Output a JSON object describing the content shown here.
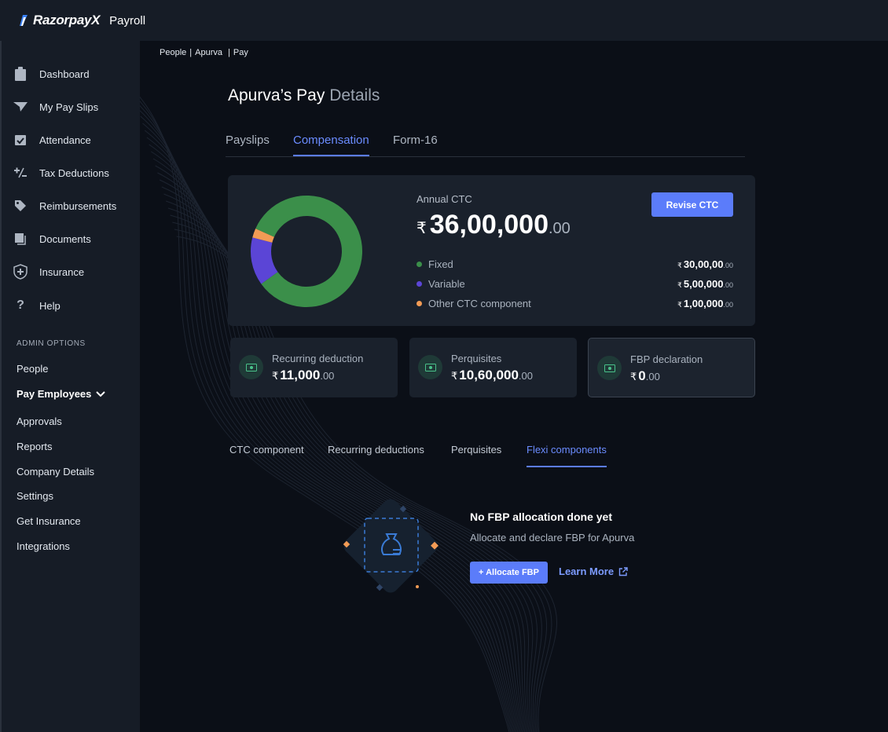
{
  "header": {
    "brand": "RazorpayX",
    "product": "Payroll"
  },
  "sidebar": {
    "items": [
      {
        "label": "Dashboard",
        "icon": "clipboard-icon"
      },
      {
        "label": "My Pay Slips",
        "icon": "paper-plane-icon"
      },
      {
        "label": "Attendance",
        "icon": "calendar-check-icon"
      },
      {
        "label": "Tax Deductions",
        "icon": "plus-minus-icon"
      },
      {
        "label": "Reimbursements",
        "icon": "tag-icon"
      },
      {
        "label": "Documents",
        "icon": "documents-icon"
      },
      {
        "label": "Insurance",
        "icon": "shield-plus-icon"
      },
      {
        "label": "Help",
        "icon": "question-icon"
      }
    ],
    "admin_title": "ADMIN OPTIONS",
    "admin_items": [
      "People",
      "Pay Employees",
      "Approvals",
      "Reports",
      "Company Details",
      "Settings",
      "Get Insurance",
      "Integrations"
    ]
  },
  "breadcrumb": [
    "People",
    "Apurva",
    "Pay"
  ],
  "page": {
    "title_strong": "Apurva’s Pay",
    "title_light": "Details"
  },
  "tabs": [
    "Payslips",
    "Compensation",
    "Form-16"
  ],
  "ctc": {
    "label": "Annual CTC",
    "currency": "₹",
    "amount": "36,00,000",
    "decimal": ".00",
    "revise_label": "Revise CTC",
    "breakdown": [
      {
        "label": "Fixed",
        "amount": "30,00,00",
        "decimal": ".00",
        "color": "#3b8f4a"
      },
      {
        "label": "Variable",
        "amount": "5,00,000",
        "decimal": ".00",
        "color": "#5b45d6"
      },
      {
        "label": "Other CTC component",
        "amount": "1,00,000",
        "decimal": ".00",
        "color": "#f29b55"
      }
    ]
  },
  "chart_data": {
    "type": "pie",
    "categories": [
      "Fixed",
      "Variable",
      "Other CTC component"
    ],
    "values": [
      3000000,
      500000,
      100000
    ]
  },
  "stats": [
    {
      "label": "Recurring deduction",
      "currency": "₹",
      "amount": "11,000",
      "decimal": ".00",
      "icon": "money-icon"
    },
    {
      "label": "Perquisites",
      "currency": "₹",
      "amount": "10,60,000",
      "decimal": ".00",
      "icon": "money-icon"
    },
    {
      "label": "FBP declaration",
      "currency": "₹",
      "amount": "0",
      "decimal": ".00",
      "icon": "money-icon"
    }
  ],
  "subtabs": [
    "CTC component",
    "Recurring deductions",
    "Perquisites",
    "Flexi components"
  ],
  "empty": {
    "title": "No FBP allocation done yet",
    "subtitle": "Allocate and declare FBP for Apurva",
    "allocate_label": "+ Allocate FBP",
    "learn_label": "Learn More"
  }
}
